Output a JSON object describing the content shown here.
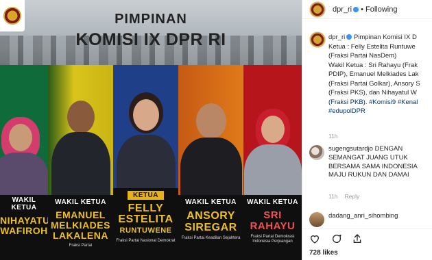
{
  "post": {
    "title_line1": "PIMPINAN",
    "title_line2": "KOMISI IX DPR RI",
    "panels": [
      {
        "role": "WAKIL KETUA",
        "name_lines": [
          "NIHAYATUL",
          "WAFIROH"
        ],
        "fraksi": "",
        "bg": "#0f6b3a",
        "hijab": "#d33d6e",
        "suit": "#5a4a6b"
      },
      {
        "role": "WAKIL KETUA",
        "name_lines": [
          "EMANUEL",
          "MELKIADES",
          "LAKALENA"
        ],
        "fraksi": "Fraksi Partai",
        "bg": "#d9c51a",
        "suit": "#22252b"
      },
      {
        "role": "KETUA",
        "name_lines": [
          "FELLY",
          "ESTELITA",
          "RUNTUWENE"
        ],
        "fraksi": "Fraksi Partai Nasional Demokrat",
        "bg": "#1f3f88",
        "suit": "#2b2e3a"
      },
      {
        "role": "WAKIL KETUA",
        "name_lines": [
          "ANSORY",
          "SIREGAR"
        ],
        "fraksi": "Fraksi Partai Keadilan Sejahtera",
        "bg": "#c65a13",
        "suit": "#1d1d22"
      },
      {
        "role": "WAKIL KETUA",
        "name_lines": [
          "SRI",
          "RAHAYU"
        ],
        "fraksi": "Fraksi Partai Demokrasi Indonesia Perjuangan",
        "bg": "#b6161b",
        "hijab": "#c81e2e",
        "suit": "#9a9ea8"
      }
    ]
  },
  "sidebar": {
    "username": "dpr_ri",
    "separator": "•",
    "following": "Following",
    "caption_user": "dpr_ri",
    "caption_lines": [
      "Pimpinan Komisi IX D",
      "Ketua : Felly Estelita Runtuwe",
      "(Fraksi Partai NasDem)",
      "Wakil Ketua : Sri Rahayu (Frak",
      "PDIP), Emanuel Melkiades Lak",
      "(Fraksi Partai Golkar), Ansory S",
      "(Fraksi PKS), dan Nihayatul W",
      "(Fraksi PKB). #Komisi9 #Kenal",
      "#edupolDPR"
    ],
    "caption_time": "11h",
    "comments": [
      {
        "user": "sugengsutardjo",
        "text_lines": [
          "DENGAN",
          "SEMANGAT JUANG UTUK",
          "BERSAMA SAMA INDONESIA",
          "MAJU RUKUN DAN DAMAI"
        ],
        "time": "11h",
        "reply": "Reply"
      },
      {
        "user": "dadang_anri_sihombing",
        "text_lines": [],
        "time": "",
        "reply": ""
      }
    ],
    "likes": "728 likes",
    "icons": [
      "heart-icon",
      "comment-icon",
      "share-icon"
    ]
  }
}
